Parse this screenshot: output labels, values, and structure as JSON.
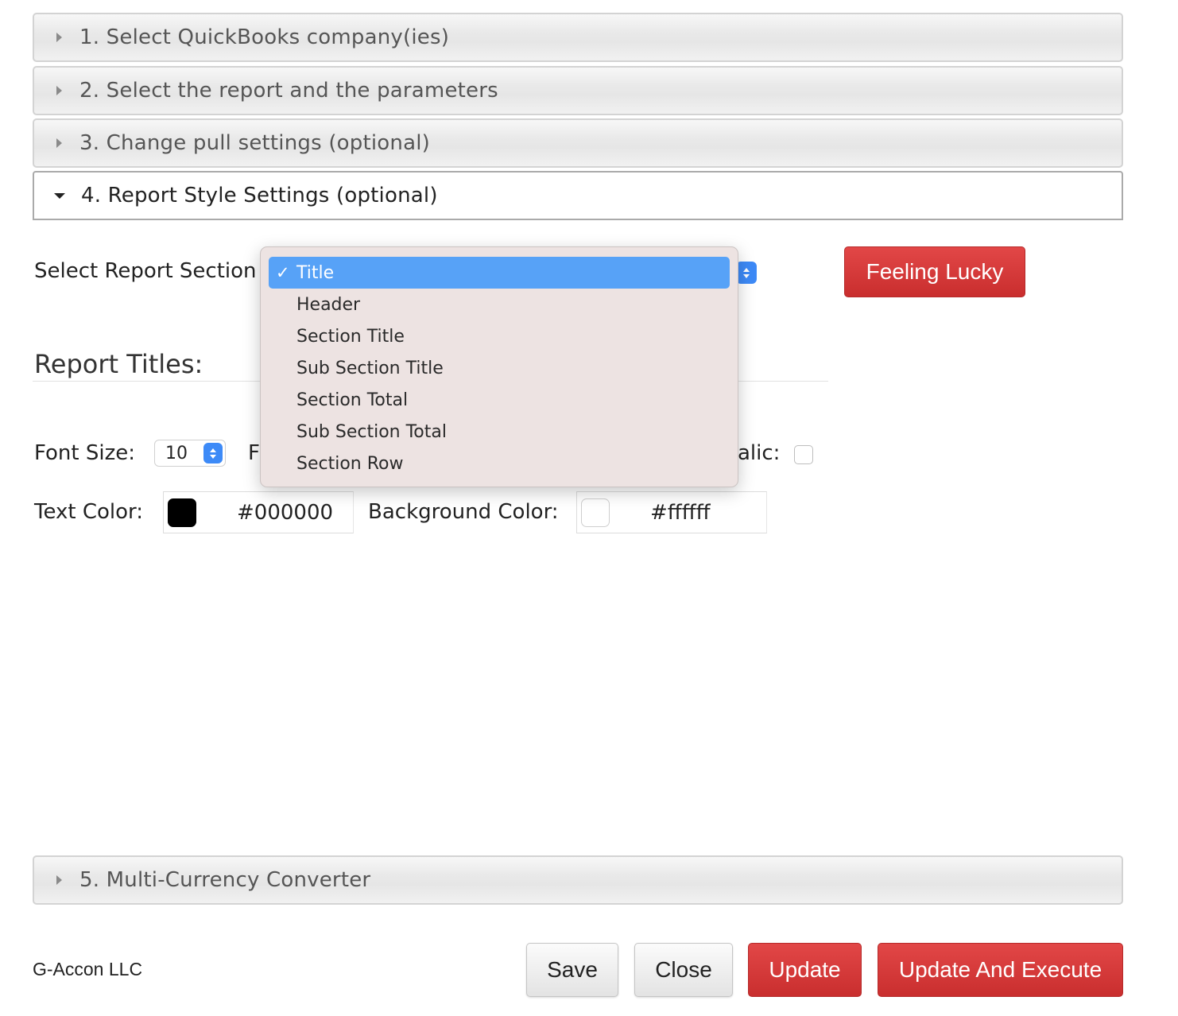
{
  "accordion": [
    {
      "label": "1. Select QuickBooks company(ies)"
    },
    {
      "label": "2. Select the report and the parameters"
    },
    {
      "label": "3. Change pull settings (optional)"
    },
    {
      "label": "4. Report Style Settings (optional)"
    },
    {
      "label": "5. Multi-Currency Converter"
    }
  ],
  "style_settings": {
    "section_label": "Select Report Section",
    "section_options": [
      "Title",
      "Header",
      "Section Title",
      "Sub Section Title",
      "Section Total",
      "Sub Section Total",
      "Section Row"
    ],
    "section_selected": "Title",
    "check_mark": "✓",
    "feeling_lucky_label": "Feeling Lucky",
    "report_titles_heading": "Report Titles:",
    "font_size_label": "Font Size:",
    "font_size_value": "10",
    "font_label_partial": "F",
    "italic_label_partial": "alic:",
    "text_color_label": "Text Color:",
    "text_color_value": "#000000",
    "background_color_label": "Background Color:",
    "background_color_value": "#ffffff"
  },
  "footer": {
    "company": "G-Accon LLC",
    "save_label": "Save",
    "close_label": "Close",
    "update_label": "Update",
    "update_execute_label": "Update And Execute"
  },
  "colors": {
    "accent_red": "#d83a3a",
    "highlight_blue": "#57a2f7",
    "stepper_blue": "#3d8af7"
  }
}
